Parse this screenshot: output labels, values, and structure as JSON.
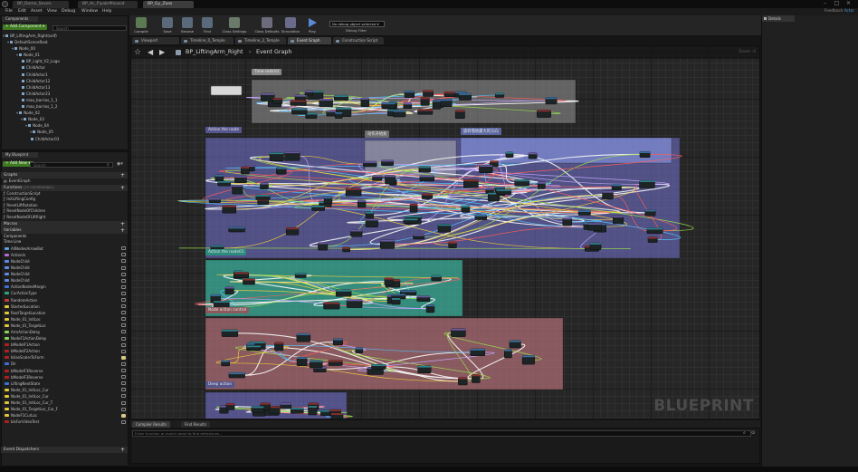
{
  "window": {
    "tabs": [
      {
        "label": "BP_Dome_Seven",
        "active": false
      },
      {
        "label": "BP_Ac_FlyabrMisasid",
        "active": false
      },
      {
        "label": "BP_Gy_Zaas",
        "active": true
      }
    ],
    "feedback_label": "Feedback",
    "feedback_user": "Actor"
  },
  "menu": {
    "items": [
      "File",
      "Edit",
      "Asset",
      "View",
      "Debug",
      "Window",
      "Help"
    ]
  },
  "components": {
    "tab": "Components",
    "add_button": "+ Add Component ▾",
    "search_placeholder": "Search",
    "tree": [
      {
        "label": "BP_LiftingArm_Right(self)",
        "indent": 0
      },
      {
        "label": "DefaultSceneRoot",
        "indent": 1
      },
      {
        "label": "Node_00",
        "indent": 2
      },
      {
        "label": "Node_01",
        "indent": 3
      },
      {
        "label": "BP_Light_V2_Logo",
        "indent": 4
      },
      {
        "label": "ChildActor",
        "indent": 4
      },
      {
        "label": "ChildActor1",
        "indent": 4
      },
      {
        "label": "ChildActor12",
        "indent": 4
      },
      {
        "label": "ChildActor13",
        "indent": 4
      },
      {
        "label": "ChildActor23",
        "indent": 4
      },
      {
        "label": "mao_barrios_1_1",
        "indent": 4
      },
      {
        "label": "mao_barrios_1_2",
        "indent": 4
      },
      {
        "label": "Node_02",
        "indent": 3
      },
      {
        "label": "Node_03",
        "indent": 4
      },
      {
        "label": "Node_04",
        "indent": 5
      },
      {
        "label": "Node_05",
        "indent": 6
      },
      {
        "label": "ChildActor03",
        "indent": 6
      }
    ]
  },
  "mybp": {
    "tab": "My Blueprint",
    "add_button": "+ Add New ▾",
    "search_placeholder": "Search",
    "graphs_header": "Graphs",
    "graphs": [
      "EventGraph"
    ],
    "functions_header": "Functions",
    "functions_count": "(20 OVERRIDABLE)",
    "functions": [
      "ConstructionScript",
      "InitLiftingConfig",
      "ResetLiftRotation",
      "ResetNodeOfChildren",
      "ResetNodeOfLiftRight"
    ],
    "macros_header": "Macros",
    "variables_header": "Variables",
    "components_header": "Components",
    "timeline_header": "Time Line",
    "variables": [
      {
        "label": "AllNodesArrowBot",
        "color": "#5aa0e8",
        "eye": false
      },
      {
        "label": "ActionIn",
        "color": "#b36ad6",
        "eye": false
      },
      {
        "label": "NodeChild",
        "color": "#5a8ce8",
        "eye": false
      },
      {
        "label": "NodeChild",
        "color": "#5a8ce8",
        "eye": false
      },
      {
        "label": "NodeChild",
        "color": "#5a8ce8",
        "eye": false
      },
      {
        "label": "NodeChild",
        "color": "#5a8ce8",
        "eye": false
      },
      {
        "label": "ActionNodesMargin",
        "color": "#3f6fd8",
        "eye": false
      },
      {
        "label": "CurActionType",
        "color": "#2aaa7a",
        "eye": false
      },
      {
        "label": "RandomAction",
        "color": "#c83a3a",
        "eye": false
      },
      {
        "label": "StartedLocation",
        "color": "#e0c83a",
        "eye": false
      },
      {
        "label": "RootTargetLocation",
        "color": "#e0c83a",
        "eye": false
      },
      {
        "label": "Node_01_InitLoc",
        "color": "#e0c83a",
        "eye": false
      },
      {
        "label": "Node_01_TargetLoc",
        "color": "#e0c83a",
        "eye": false
      },
      {
        "label": "ArmActionDelay",
        "color": "#84d65a",
        "eye": false
      },
      {
        "label": "NodeF1ActionDelay",
        "color": "#84d65a",
        "eye": false
      },
      {
        "label": "bModelF1Action",
        "color": "#b02020",
        "eye": false
      },
      {
        "label": "bModelF2Action",
        "color": "#b02020",
        "eye": false
      },
      {
        "label": "bUseScalerToForm",
        "color": "#b02020",
        "eye": true
      },
      {
        "label": "Dir",
        "color": "#3f6fd8",
        "eye": false
      },
      {
        "label": "bModelF3Reverse",
        "color": "#b02020",
        "eye": false
      },
      {
        "label": "bModelF3Reverse",
        "color": "#b02020",
        "eye": false
      },
      {
        "label": "LiftingNextState",
        "color": "#3f6fd8",
        "eye": false
      },
      {
        "label": "Node_01_InitLoc_Cur",
        "color": "#e0c83a",
        "eye": false
      },
      {
        "label": "Node_01_InitLoc_Cur",
        "color": "#e0c83a",
        "eye": false
      },
      {
        "label": "Node_01_InitLoc_Cur_T",
        "color": "#e0c83a",
        "eye": false
      },
      {
        "label": "Node_01_TargetLoc_Cur_F",
        "color": "#e0c83a",
        "eye": false
      },
      {
        "label": "NodeF1CurLoc",
        "color": "#e0c83a",
        "eye": true
      },
      {
        "label": "bIsForVideoTest",
        "color": "#b02020",
        "eye": false
      }
    ],
    "dispatchers_header": "Event Dispatchers"
  },
  "toolbar": {
    "buttons": [
      {
        "label": "Compile",
        "icon": "compile-icon",
        "color": "#5c7a52"
      },
      {
        "label": "Save",
        "icon": "save-icon",
        "color": "#5a6a7a"
      },
      {
        "label": "Browse",
        "icon": "browse-icon",
        "color": "#5a6a7a"
      },
      {
        "label": "Find",
        "icon": "find-icon",
        "color": "#5a6a7a"
      },
      {
        "label": "Class Settings",
        "icon": "gear-icon",
        "color": "#6b7b6b"
      },
      {
        "label": "Class Defaults",
        "icon": "defaults-icon",
        "color": "#6b6b7b"
      },
      {
        "label": "Simulation",
        "icon": "simulation-icon",
        "color": "#6a6a8a"
      },
      {
        "label": "Play",
        "icon": "play-icon",
        "color": "#5a8ad6"
      }
    ],
    "debug_select": "No debug object selected ▾",
    "debug_label": "Debug Filter"
  },
  "editor_tabs": [
    {
      "label": "Viewport",
      "active": false
    },
    {
      "label": "Timeline_0_Temple",
      "active": false
    },
    {
      "label": "Timeline_2_Temple",
      "active": false
    },
    {
      "label": "Event Graph",
      "active": true
    },
    {
      "label": "Construction Script",
      "active": false
    }
  ],
  "graph": {
    "breadcrumb": [
      "BP_LiftingArm_Right",
      "Event Graph"
    ],
    "breadcrumb_sep": "›",
    "zoom": "Zoom -4",
    "watermark": "BLUEPRINT",
    "comments": [
      {
        "label": "Time restrict",
        "color": "#8a8a8a"
      },
      {
        "label": "Action the node",
        "color": "#56568f"
      },
      {
        "label": "动作开始处",
        "color": "#6c6c6c"
      },
      {
        "label": "旋转落地最大的方向",
        "color": "#5a66a0"
      },
      {
        "label": "Action the node01",
        "color": "#2d8c7e"
      },
      {
        "label": "Node action control",
        "color": "#8c5a5c"
      },
      {
        "label": "Deep action",
        "color": "#56568f"
      }
    ]
  },
  "bottom": {
    "tabs": [
      {
        "label": "Compiler Results",
        "active": true
      },
      {
        "label": "Find Results",
        "active": false
      }
    ],
    "search_placeholder": "Enter function or event name to find references..."
  },
  "details": {
    "tab": "Details"
  }
}
